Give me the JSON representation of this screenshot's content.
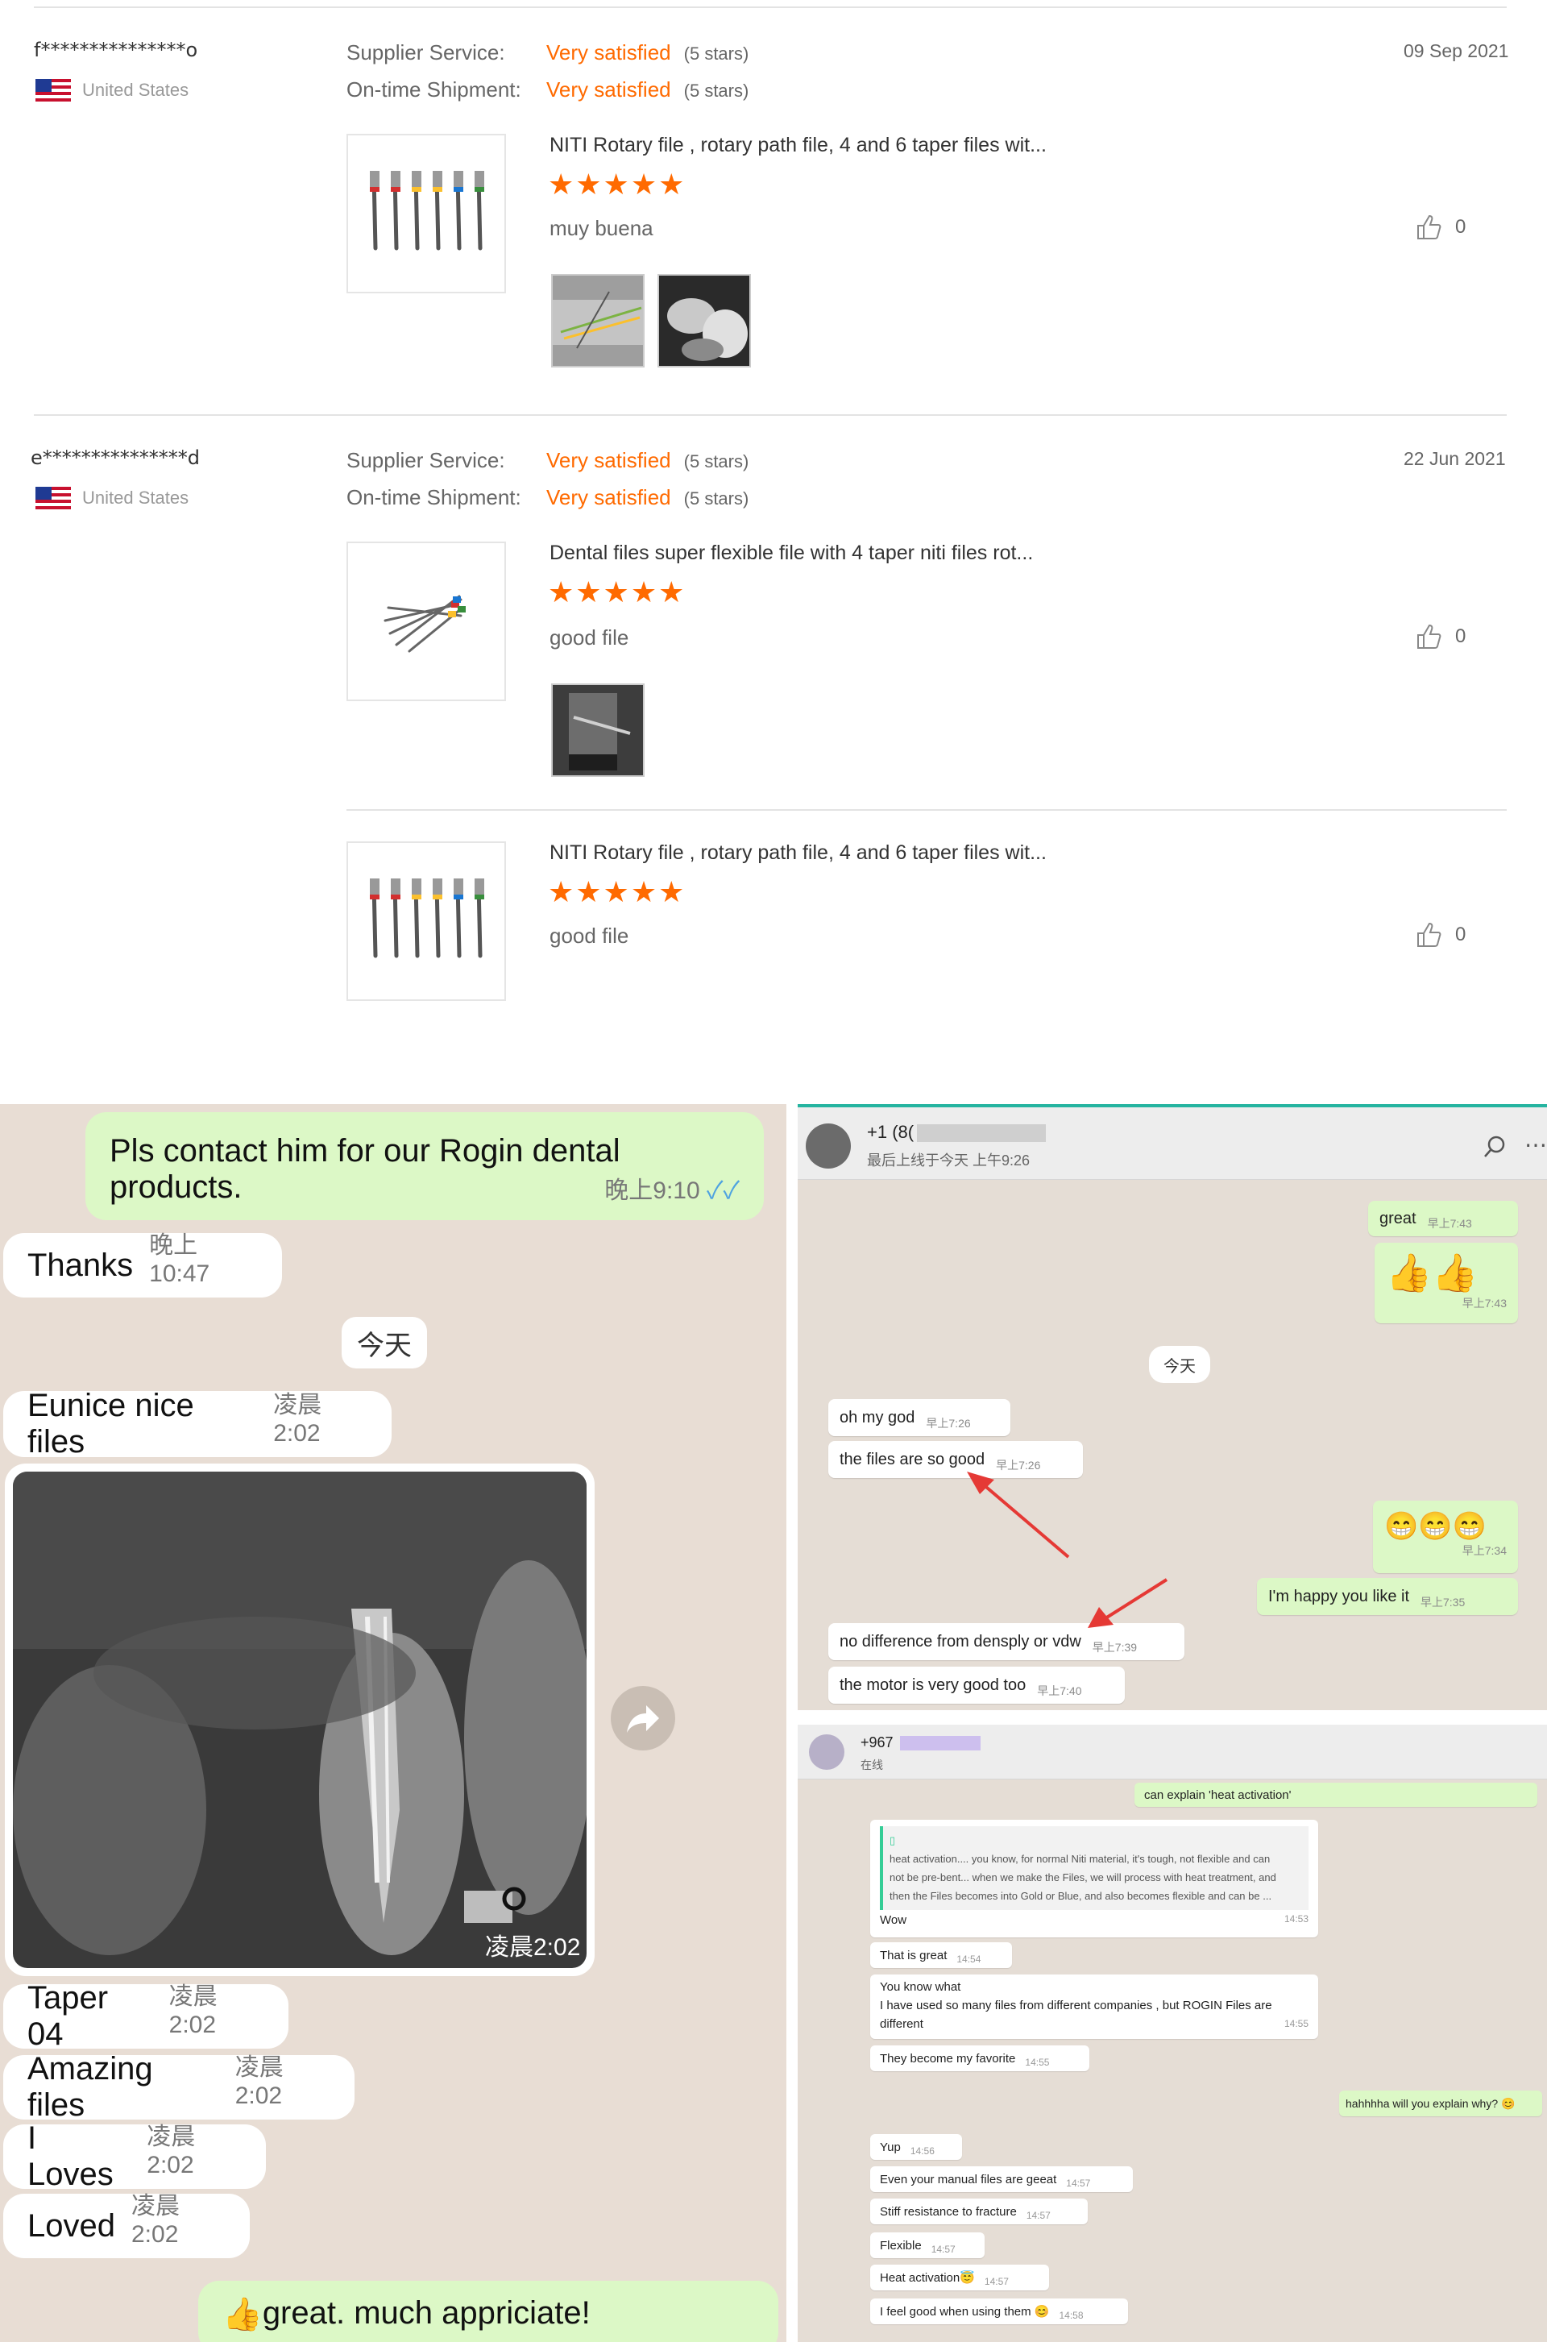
{
  "reviews": [
    {
      "buyer": "f***************o",
      "country": "United States",
      "supplier_label": "Supplier Service:",
      "supplier_value": "Very satisfied",
      "supplier_stars": "(5 stars)",
      "shipment_label": "On-time Shipment:",
      "shipment_value": "Very satisfied",
      "shipment_stars": "(5 stars)",
      "date": "09 Sep 2021",
      "product": "NITI Rotary file , rotary path file, 4 and 6 taper files wit...",
      "rating": "★★★★★",
      "comment": "muy buena",
      "likes": "0"
    },
    {
      "buyer": "e***************d",
      "country": "United States",
      "supplier_label": "Supplier Service:",
      "supplier_value": "Very satisfied",
      "supplier_stars": "(5 stars)",
      "shipment_label": "On-time Shipment:",
      "shipment_value": "Very satisfied",
      "shipment_stars": "(5 stars)",
      "date": "22 Jun 2021",
      "product": "Dental files super flexible file with 4 taper niti files rot...",
      "rating": "★★★★★",
      "comment": "good file",
      "likes": "0"
    },
    {
      "product": "NITI Rotary file , rotary path file, 4 and 6 taper files wit...",
      "rating": "★★★★★",
      "comment": "good file",
      "likes": "0"
    }
  ],
  "left_chat": {
    "msg1_line1": "Pls contact him for our Rogin dental",
    "msg1_line2": "products.",
    "msg1_time": "晚上9:10",
    "msg2": "Thanks",
    "msg2_time": "晚上10:47",
    "day": "今天",
    "msg3": "Eunice nice files",
    "msg3_time": "凌晨2:02",
    "xray_time": "凌晨2:02",
    "msg4": "Taper 04",
    "msg4_time": "凌晨2:02",
    "msg5": "Amazing files",
    "msg5_time": "凌晨2:02",
    "msg6": "I Loves",
    "msg6_time": "凌晨2:02",
    "msg7": "Loved",
    "msg7_time": "凌晨2:02",
    "msg8": "great. much appriciate!",
    "msg8_emoji": "👍"
  },
  "wa_top": {
    "name": "+1 (8(",
    "status": "最后上线于今天 上午9:26",
    "m1": "great",
    "m1_time": "早上7:43",
    "m2": "👍👍",
    "m2_time": "早上7:43",
    "day": "今天",
    "m3": "oh my god",
    "m3_time": "早上7:26",
    "m4": "the files are so good",
    "m4_time": "早上7:26",
    "m5": "😁😁😁",
    "m5_time": "早上7:34",
    "m6": "I'm happy you like it",
    "m6_time": "早上7:35",
    "m7": "no difference from densply or vdw",
    "m7_time": "早上7:39",
    "m8": "the motor is very good too",
    "m8_time": "早上7:40"
  },
  "wa_bot": {
    "name": "+967",
    "status": "在线",
    "quote_top": "can explain 'heat activation'",
    "quoted_1": "heat activation.... you know, for normal Niti material, it's tough, not flexible and can",
    "quoted_2": "not be pre-bent... when we make the Files, we will process with heat treatment, and",
    "quoted_3": "then the Files becomes into Gold or Blue, and also becomes flexible and can be ...",
    "q_reply": "Wow",
    "q_time": "14:53",
    "b1": "That is great",
    "b1_time": "14:54",
    "b2_line1": "You know what",
    "b2_line2": "I have used so many files from different companies , but ROGIN Files are",
    "b2_line3": "different",
    "b2_time": "14:55",
    "b3": "They become my favorite",
    "b3_time": "14:55",
    "o1": "hahhhha will you explain why? 😊",
    "b4": "Yup",
    "b4_time": "14:56",
    "b5": "Even your manual files are geeat",
    "b5_time": "14:57",
    "b6": "Stiff resistance to fracture",
    "b6_time": "14:57",
    "b7": "Flexible",
    "b7_time": "14:57",
    "b8": "Heat activation😇",
    "b8_time": "14:57",
    "b9": "I feel good when using them 😊",
    "b9_time": "14:58"
  },
  "colors": {
    "accent": "#ff6a00",
    "wa_out": "#dcf8c6",
    "arrow": "#e53935"
  },
  "icons": [
    "thumbs-up-icon",
    "forward-icon",
    "search-icon",
    "more-icon",
    "us-flag-icon"
  ]
}
